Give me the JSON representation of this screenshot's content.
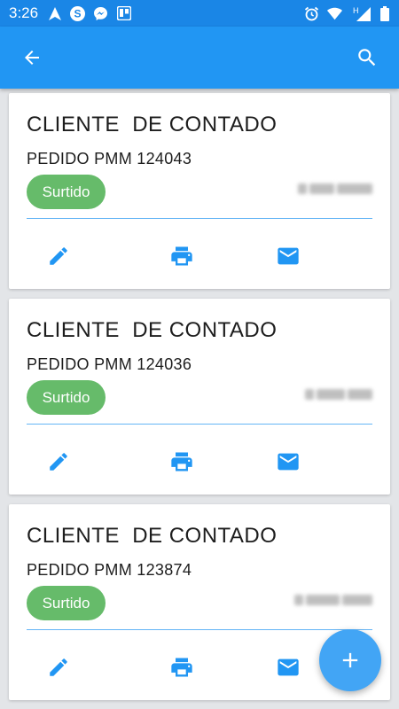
{
  "status_bar": {
    "time": "3:26",
    "network_label": "H"
  },
  "app_bar": {
    "icons": [
      "arrow-back-icon",
      "search-icon"
    ]
  },
  "colors": {
    "status_bar": "#1a86e6",
    "app_bar": "#2196f3",
    "chip": "#66bb6a",
    "action_icon": "#2196f3",
    "fab": "#42a5f5"
  },
  "orders": [
    {
      "client": "CLIENTE  DE CONTADO",
      "order": "PEDIDO PMM 124043",
      "status": "Surtido"
    },
    {
      "client": "CLIENTE  DE CONTADO",
      "order": "PEDIDO PMM 124036",
      "status": "Surtido"
    },
    {
      "client": "CLIENTE  DE CONTADO",
      "order": "PEDIDO PMM 123874",
      "status": "Surtido"
    }
  ],
  "card_actions": [
    "edit-icon",
    "print-icon",
    "mail-icon"
  ],
  "fab": {
    "icon": "add-icon"
  }
}
